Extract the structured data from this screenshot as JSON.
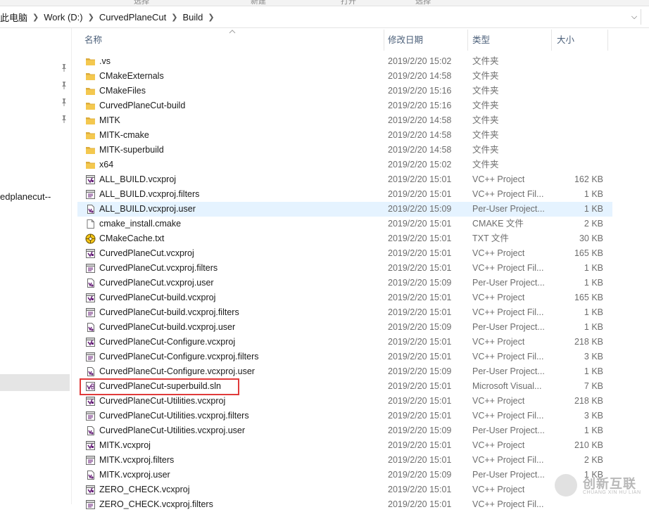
{
  "ribbon": {
    "labels": [
      "选择",
      "新建",
      "打开",
      "选择"
    ]
  },
  "address": {
    "crumbs": [
      "此电脑",
      "Work (D:)",
      "CurvedPlaneCut",
      "Build"
    ]
  },
  "nav": {
    "partial_item": "edplanecut--"
  },
  "columns": {
    "name": "名称",
    "date": "修改日期",
    "type": "类型",
    "size": "大小"
  },
  "files": [
    {
      "name": ".vs",
      "date": "2019/2/20 15:02",
      "type": "文件夹",
      "size": "",
      "icon": "folder-icon"
    },
    {
      "name": "CMakeExternals",
      "date": "2019/2/20 14:58",
      "type": "文件夹",
      "size": "",
      "icon": "folder-icon"
    },
    {
      "name": "CMakeFiles",
      "date": "2019/2/20 15:16",
      "type": "文件夹",
      "size": "",
      "icon": "folder-icon"
    },
    {
      "name": "CurvedPlaneCut-build",
      "date": "2019/2/20 15:16",
      "type": "文件夹",
      "size": "",
      "icon": "folder-icon"
    },
    {
      "name": "MITK",
      "date": "2019/2/20 14:58",
      "type": "文件夹",
      "size": "",
      "icon": "folder-icon"
    },
    {
      "name": "MITK-cmake",
      "date": "2019/2/20 14:58",
      "type": "文件夹",
      "size": "",
      "icon": "folder-icon"
    },
    {
      "name": "MITK-superbuild",
      "date": "2019/2/20 14:58",
      "type": "文件夹",
      "size": "",
      "icon": "folder-icon"
    },
    {
      "name": "x64",
      "date": "2019/2/20 15:02",
      "type": "文件夹",
      "size": "",
      "icon": "folder-icon"
    },
    {
      "name": "ALL_BUILD.vcxproj",
      "date": "2019/2/20 15:01",
      "type": "VC++ Project",
      "size": "162 KB",
      "icon": "vcxproj-icon"
    },
    {
      "name": "ALL_BUILD.vcxproj.filters",
      "date": "2019/2/20 15:01",
      "type": "VC++ Project Fil...",
      "size": "1 KB",
      "icon": "filters-file-icon"
    },
    {
      "name": "ALL_BUILD.vcxproj.user",
      "date": "2019/2/20 15:09",
      "type": "Per-User Project...",
      "size": "1 KB",
      "icon": "user-file-icon"
    },
    {
      "name": "cmake_install.cmake",
      "date": "2019/2/20 15:01",
      "type": "CMAKE 文件",
      "size": "2 KB",
      "icon": "blank-file-icon"
    },
    {
      "name": "CMakeCache.txt",
      "date": "2019/2/20 15:01",
      "type": "TXT 文件",
      "size": "30 KB",
      "icon": "txt-file-icon"
    },
    {
      "name": "CurvedPlaneCut.vcxproj",
      "date": "2019/2/20 15:01",
      "type": "VC++ Project",
      "size": "165 KB",
      "icon": "vcxproj-icon"
    },
    {
      "name": "CurvedPlaneCut.vcxproj.filters",
      "date": "2019/2/20 15:01",
      "type": "VC++ Project Fil...",
      "size": "1 KB",
      "icon": "filters-file-icon"
    },
    {
      "name": "CurvedPlaneCut.vcxproj.user",
      "date": "2019/2/20 15:09",
      "type": "Per-User Project...",
      "size": "1 KB",
      "icon": "user-file-icon"
    },
    {
      "name": "CurvedPlaneCut-build.vcxproj",
      "date": "2019/2/20 15:01",
      "type": "VC++ Project",
      "size": "165 KB",
      "icon": "vcxproj-icon"
    },
    {
      "name": "CurvedPlaneCut-build.vcxproj.filters",
      "date": "2019/2/20 15:01",
      "type": "VC++ Project Fil...",
      "size": "1 KB",
      "icon": "filters-file-icon"
    },
    {
      "name": "CurvedPlaneCut-build.vcxproj.user",
      "date": "2019/2/20 15:09",
      "type": "Per-User Project...",
      "size": "1 KB",
      "icon": "user-file-icon"
    },
    {
      "name": "CurvedPlaneCut-Configure.vcxproj",
      "date": "2019/2/20 15:01",
      "type": "VC++ Project",
      "size": "218 KB",
      "icon": "vcxproj-icon"
    },
    {
      "name": "CurvedPlaneCut-Configure.vcxproj.filters",
      "date": "2019/2/20 15:01",
      "type": "VC++ Project Fil...",
      "size": "3 KB",
      "icon": "filters-file-icon"
    },
    {
      "name": "CurvedPlaneCut-Configure.vcxproj.user",
      "date": "2019/2/20 15:09",
      "type": "Per-User Project...",
      "size": "1 KB",
      "icon": "user-file-icon"
    },
    {
      "name": "CurvedPlaneCut-superbuild.sln",
      "date": "2019/2/20 15:01",
      "type": "Microsoft Visual...",
      "size": "7 KB",
      "icon": "sln-file-icon"
    },
    {
      "name": "CurvedPlaneCut-Utilities.vcxproj",
      "date": "2019/2/20 15:01",
      "type": "VC++ Project",
      "size": "218 KB",
      "icon": "vcxproj-icon"
    },
    {
      "name": "CurvedPlaneCut-Utilities.vcxproj.filters",
      "date": "2019/2/20 15:01",
      "type": "VC++ Project Fil...",
      "size": "3 KB",
      "icon": "filters-file-icon"
    },
    {
      "name": "CurvedPlaneCut-Utilities.vcxproj.user",
      "date": "2019/2/20 15:09",
      "type": "Per-User Project...",
      "size": "1 KB",
      "icon": "user-file-icon"
    },
    {
      "name": "MITK.vcxproj",
      "date": "2019/2/20 15:01",
      "type": "VC++ Project",
      "size": "210 KB",
      "icon": "vcxproj-icon"
    },
    {
      "name": "MITK.vcxproj.filters",
      "date": "2019/2/20 15:01",
      "type": "VC++ Project Fil...",
      "size": "2 KB",
      "icon": "filters-file-icon"
    },
    {
      "name": "MITK.vcxproj.user",
      "date": "2019/2/20 15:09",
      "type": "Per-User Project...",
      "size": "1 KB",
      "icon": "user-file-icon"
    },
    {
      "name": "ZERO_CHECK.vcxproj",
      "date": "2019/2/20 15:01",
      "type": "VC++ Project",
      "size": "",
      "icon": "vcxproj-icon"
    },
    {
      "name": "ZERO_CHECK.vcxproj.filters",
      "date": "2019/2/20 15:01",
      "type": "VC++ Project Fil...",
      "size": "",
      "icon": "filters-file-icon"
    }
  ],
  "hover_row": "ALL_BUILD.vcxproj.user",
  "highlighted_file": "CurvedPlaneCut-superbuild.sln",
  "watermark": {
    "cn": "创新互联",
    "en": "CHUANG XIN HU LIAN"
  },
  "colors": {
    "folder": "#f4c84f",
    "vcxproj": "#68217a",
    "highlight_box": "#e03a3a",
    "hover_row": "#e5f3ff",
    "header_text": "#4c607a"
  }
}
